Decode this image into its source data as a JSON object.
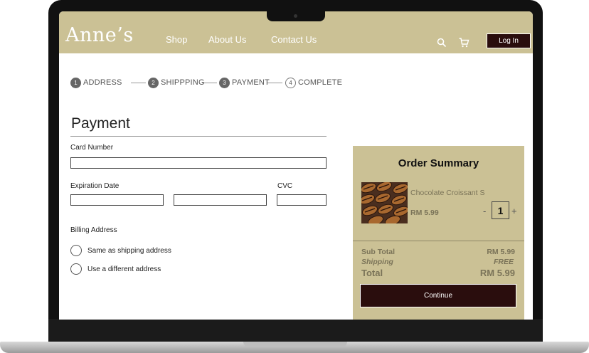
{
  "header": {
    "logo": "Anne’s",
    "nav": [
      "Shop",
      "About Us",
      "Contact Us"
    ],
    "search_icon": "search-icon",
    "cart_icon": "cart-icon",
    "login_label": "Log In"
  },
  "stepper": [
    {
      "num": "1",
      "label": "ADDRESS",
      "state": "done"
    },
    {
      "num": "2",
      "label": "SHIPPPING",
      "state": "done"
    },
    {
      "num": "3",
      "label": "PAYMENT",
      "state": "current"
    },
    {
      "num": "4",
      "label": "COMPLETE",
      "state": "pending"
    }
  ],
  "form": {
    "title": "Payment",
    "card_number_label": "Card Number",
    "card_number_value": "",
    "expiration_label": "Expiration Date",
    "expiration_month_value": "",
    "expiration_year_value": "",
    "cvc_label": "CVC",
    "cvc_value": "",
    "billing_label": "Billing Address",
    "billing_options": [
      "Same as shipping address",
      "Use a different address"
    ]
  },
  "summary": {
    "title": "Order Summary",
    "product_name": "Chocolate Croissant S",
    "product_price": "RM 5.99",
    "quantity": "1",
    "qty_minus": "-",
    "qty_plus": "+",
    "subtotal_label": "Sub Total",
    "subtotal_value": "RM 5.99",
    "shipping_label": "Shipping",
    "shipping_value": "FREE",
    "total_label": "Total",
    "total_value": "RM 5.99",
    "continue_label": "Continue"
  },
  "colors": {
    "brand_beige": "#cbc195",
    "button_dark": "#2a0d0d"
  }
}
